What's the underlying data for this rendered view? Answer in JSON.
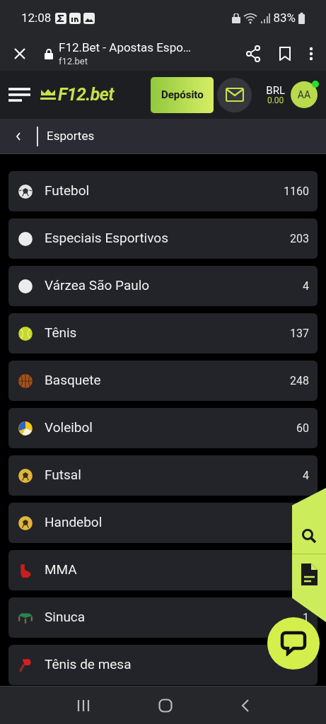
{
  "status_bar": {
    "time": "12:08",
    "battery": "83%"
  },
  "browser": {
    "title": "F12.Bet - Apostas Espo…",
    "url": "f12.bet"
  },
  "header": {
    "logo": "F12.bet",
    "deposit_button": "Depósito",
    "currency": "BRL",
    "balance": "0.00",
    "avatar": "AA",
    "online": true
  },
  "breadcrumb": {
    "title": "Esportes"
  },
  "sports": [
    {
      "name": "Futebol",
      "count": "1160",
      "kind": "soccer"
    },
    {
      "name": "Especiais Esportivos",
      "count": "203",
      "kind": "plain"
    },
    {
      "name": "Várzea São Paulo",
      "count": "4",
      "kind": "plain"
    },
    {
      "name": "Tênis",
      "count": "137",
      "kind": "tennis"
    },
    {
      "name": "Basquete",
      "count": "248",
      "kind": "basketball"
    },
    {
      "name": "Voleibol",
      "count": "60",
      "kind": "volleyball"
    },
    {
      "name": "Futsal",
      "count": "4",
      "kind": "futsal"
    },
    {
      "name": "Handebol",
      "kind": "futsal"
    },
    {
      "name": "MMA",
      "kind": "glove"
    },
    {
      "name": "Sinuca",
      "count": "1",
      "kind": "pool"
    },
    {
      "name": "Tênis de mesa",
      "kind": "pingpong"
    }
  ]
}
